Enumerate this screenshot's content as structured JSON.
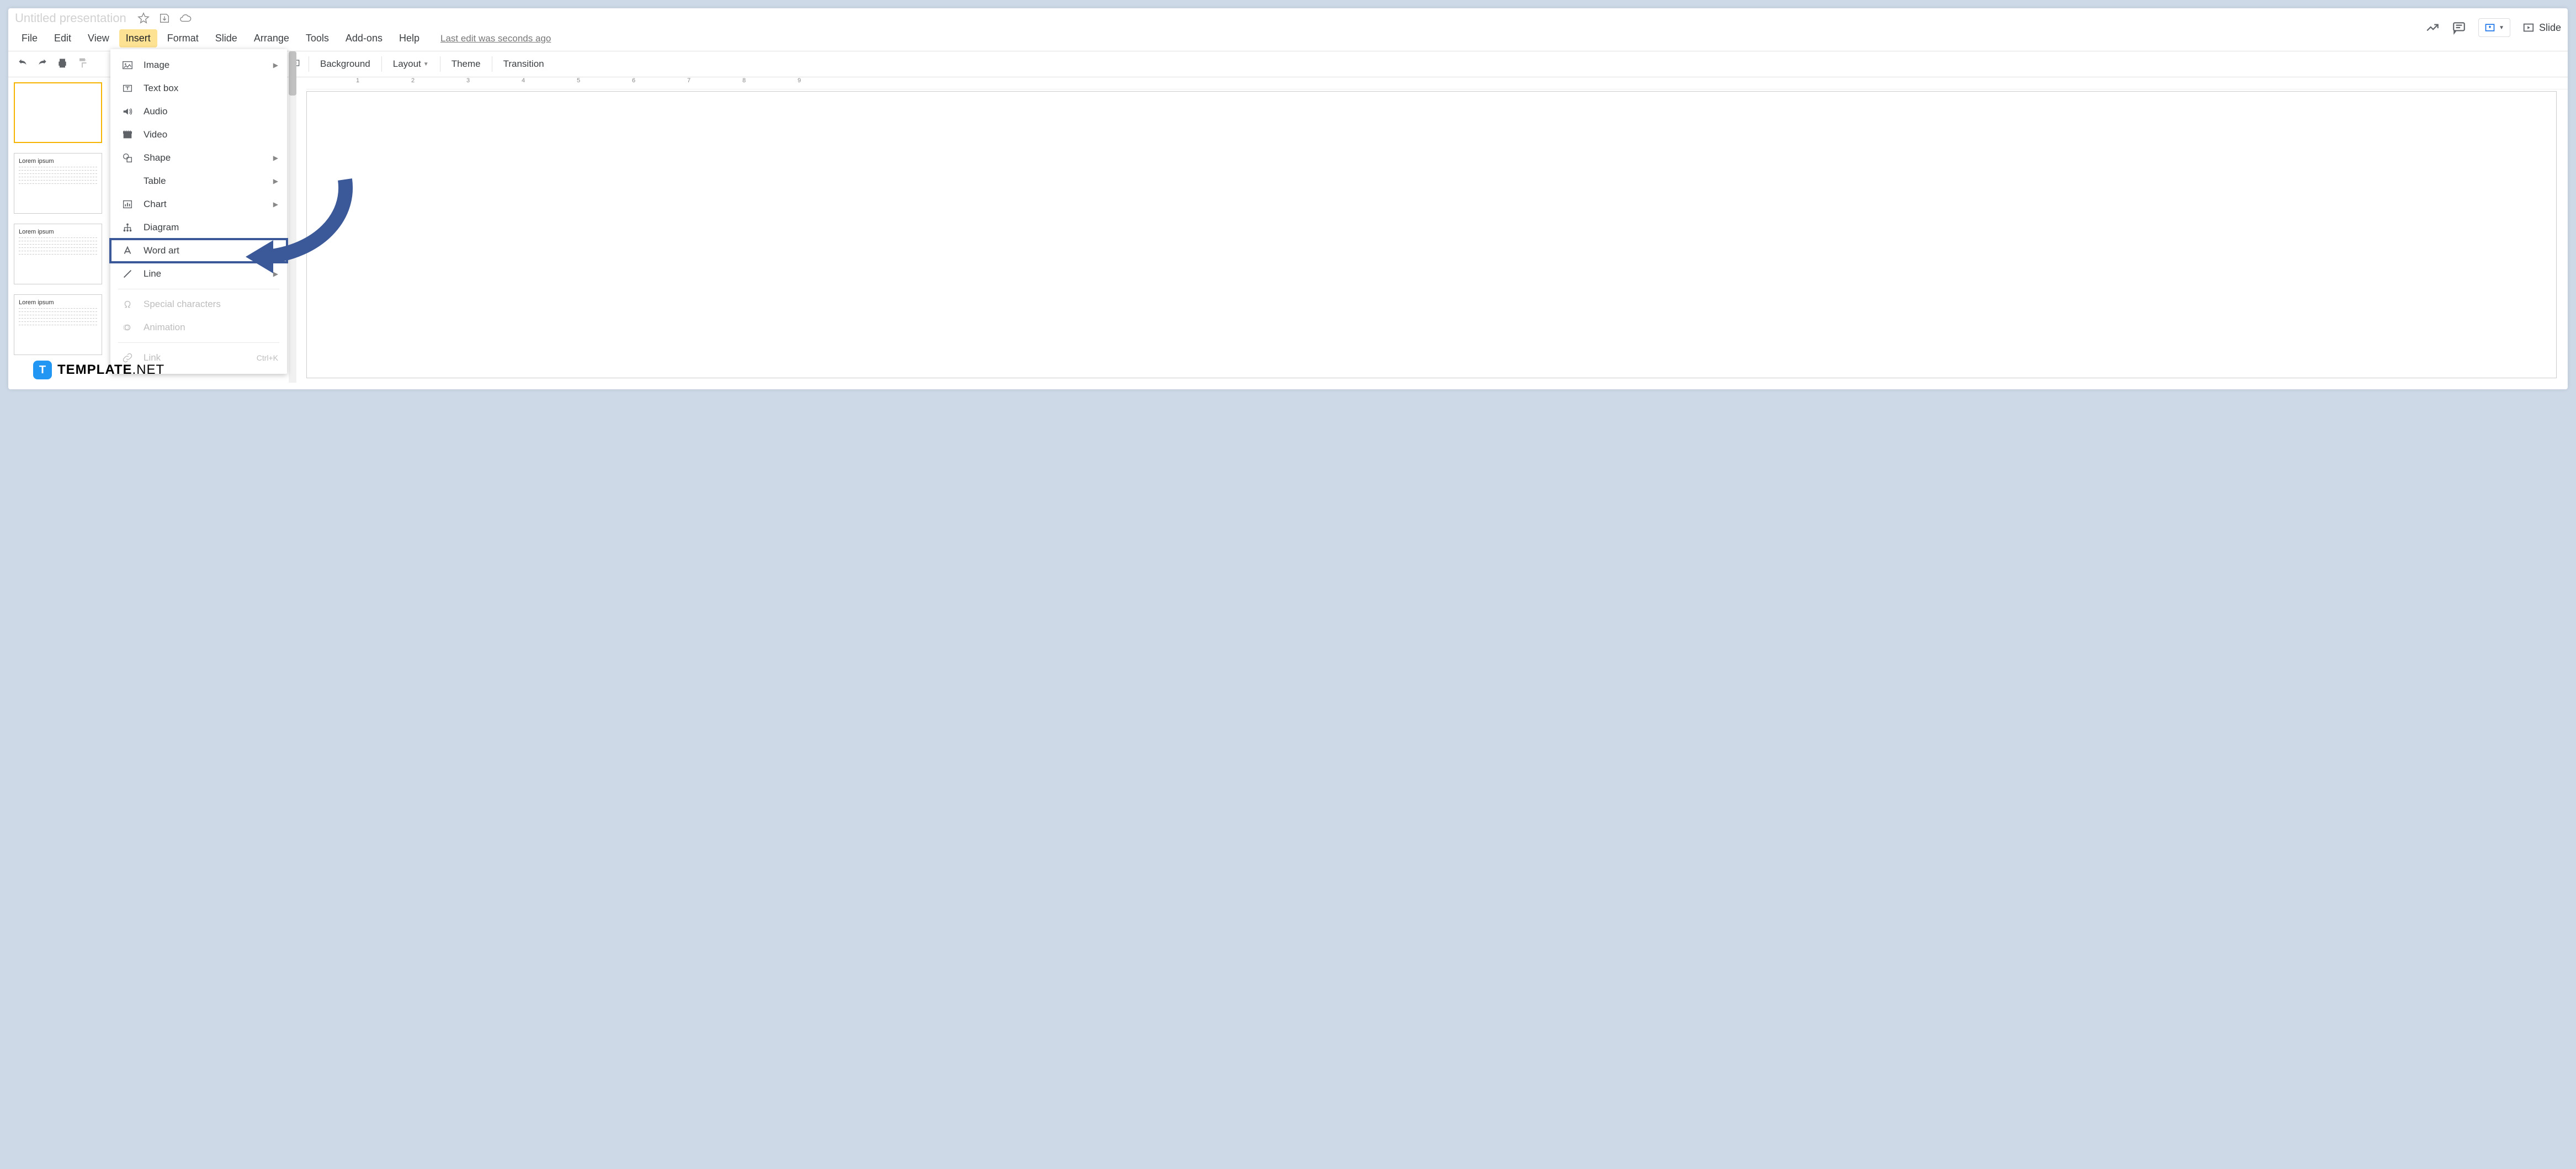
{
  "title": "Untitled presentation",
  "menubar": [
    "File",
    "Edit",
    "View",
    "Insert",
    "Format",
    "Slide",
    "Arrange",
    "Tools",
    "Add-ons",
    "Help"
  ],
  "active_menu_index": 3,
  "last_edit": "Last edit was seconds ago",
  "slideshow_label": "Slide",
  "toolbar": {
    "background": "Background",
    "layout": "Layout",
    "theme": "Theme",
    "transition": "Transition"
  },
  "ruler_numbers": [
    1,
    2,
    3,
    4,
    5,
    6,
    7,
    8,
    9
  ],
  "thumbs": [
    {
      "title": ""
    },
    {
      "title": "Lorem ipsum"
    },
    {
      "title": "Lorem ipsum"
    },
    {
      "title": "Lorem ipsum"
    }
  ],
  "insert_menu": [
    {
      "label": "Image",
      "icon": "image",
      "arrow": true
    },
    {
      "label": "Text box",
      "icon": "textbox"
    },
    {
      "label": "Audio",
      "icon": "audio"
    },
    {
      "label": "Video",
      "icon": "video"
    },
    {
      "label": "Shape",
      "icon": "shape",
      "arrow": true
    },
    {
      "label": "Table",
      "icon": "table",
      "arrow": true,
      "noicon": true
    },
    {
      "label": "Chart",
      "icon": "chart",
      "arrow": true
    },
    {
      "label": "Diagram",
      "icon": "diagram"
    },
    {
      "label": "Word art",
      "icon": "wordart",
      "highlight": true
    },
    {
      "label": "Line",
      "icon": "line",
      "arrow": true
    },
    {
      "sep": true
    },
    {
      "label": "Special characters",
      "icon": "omega",
      "disabled": true
    },
    {
      "label": "Animation",
      "icon": "animation",
      "disabled": true
    },
    {
      "sep": true
    },
    {
      "label": "Link",
      "icon": "link",
      "disabled": true,
      "shortcut": "Ctrl+K"
    }
  ],
  "logo": {
    "brand_bold": "TEMPLATE",
    "brand_light": ".NET",
    "icon_letter": "T"
  }
}
